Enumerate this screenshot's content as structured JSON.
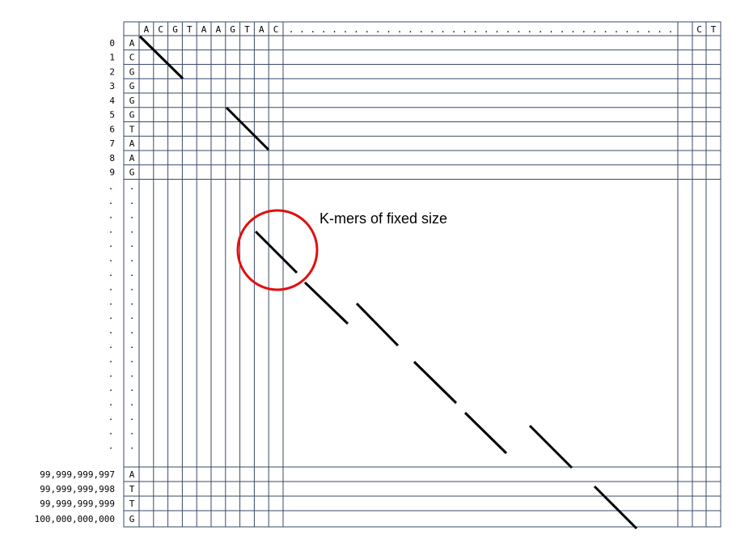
{
  "top_sequence": [
    "A",
    "C",
    "G",
    "T",
    "A",
    "A",
    "G",
    "T",
    "A",
    "C"
  ],
  "top_sequence_tail": [
    "C",
    "T"
  ],
  "left_sequence": [
    "A",
    "C",
    "G",
    "G",
    "G",
    "G",
    "T",
    "A",
    "A",
    "G"
  ],
  "left_sequence_tail": [
    "A",
    "T",
    "T",
    "G"
  ],
  "row_indices": [
    "0",
    "1",
    "2",
    "3",
    "4",
    "5",
    "6",
    "7",
    "8",
    "9"
  ],
  "row_indices_tail": [
    "99,999,999,997",
    "99,999,999,998",
    "99,999,999,999",
    "100,000,000,000"
  ],
  "ellipsis": ".",
  "annotation": {
    "label": "K-mers of fixed size",
    "circle_color": "#e01010"
  },
  "colors": {
    "grid": "#3a4a6a",
    "match_line": "#000000"
  }
}
